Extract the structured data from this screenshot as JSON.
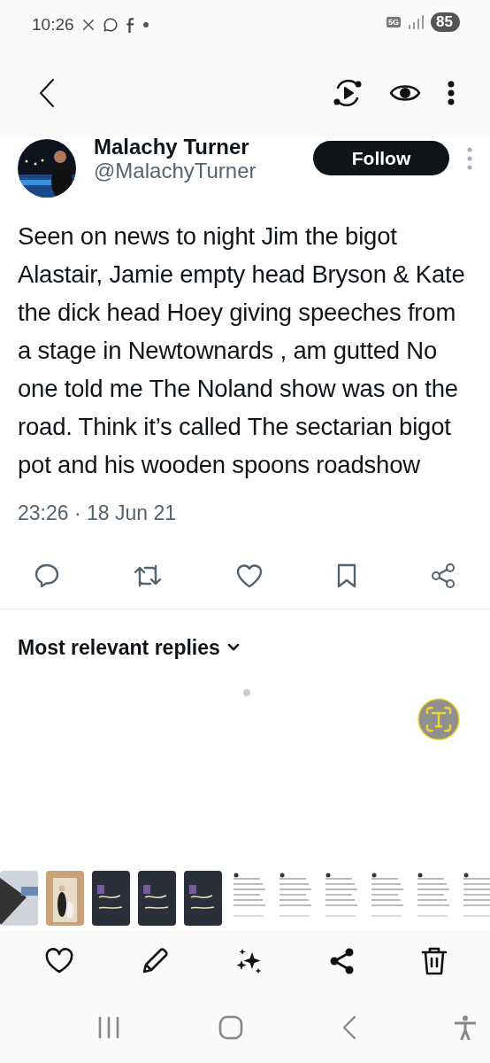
{
  "status_bar": {
    "time": "10:26",
    "network": "5G",
    "battery": "85"
  },
  "tweet": {
    "author_name": "Malachy Turner",
    "handle": "@MalachyTurner",
    "follow_label": "Follow",
    "text": "Seen on news to night Jim the bigot Alastair, Jamie empty head Bryson & Kate  the dick  head Hoey giving speeches from a stage in Newtownards , am gutted No one told me The Noland show was on the road. Think it’s called  The sectarian bigot pot and his wooden spoons roadshow",
    "timestamp": "23:26 · 18 Jun 21"
  },
  "replies": {
    "heading": "Most relevant replies"
  }
}
